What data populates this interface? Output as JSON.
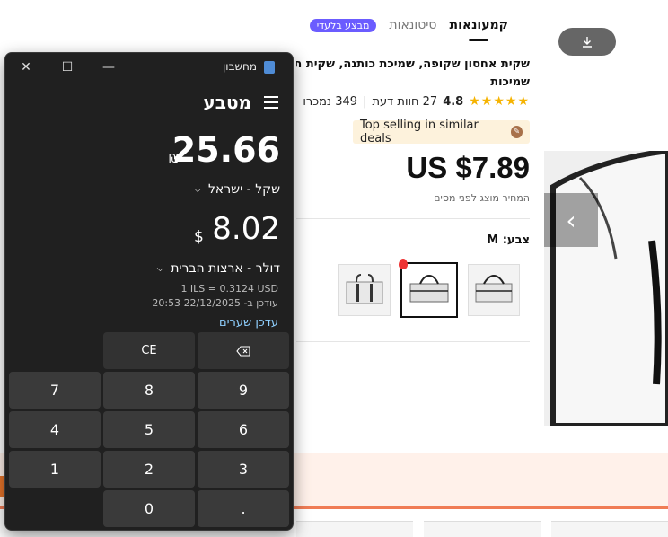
{
  "page": {
    "tabs": {
      "active": "קמעונאות",
      "other": "סיטונאות",
      "badge": "מבצע בלעדי"
    },
    "title_line1": "שקית אחסון שקופה, שמיכת כותנה, שקית תנועה",
    "title_line2": "שמיכות",
    "rating": "4.8",
    "reviews": "27 חוות דעת",
    "sold": "349 נמכרו",
    "top_selling": "Top selling in similar deals",
    "price": "US $7.89",
    "price_note": "המחיר מוצג לפני מסים",
    "color_label": "צבע: M"
  },
  "calculator": {
    "app_title": "מחשבון",
    "mode": "מטבע",
    "value1": "25.66",
    "symbol1": "₪",
    "unit1": "שקל - ישראל",
    "value2": "8.02",
    "symbol2": "$",
    "unit2": "דולר - ארצות הברית",
    "rate": "1 ILS = 0.3124 USD",
    "updated": "עודכן ב- 22/12/2025 20:53",
    "update_link": "עדכן שערים",
    "keys": {
      "ce": "CE",
      "k7": "7",
      "k8": "8",
      "k9": "9",
      "k4": "4",
      "k5": "5",
      "k6": "6",
      "k1": "1",
      "k2": "2",
      "k3": "3",
      "k0": "0",
      "dot": "."
    }
  },
  "colors": {
    "accent_badge": "#6b5cff",
    "calc_bg": "#202020",
    "calc_key": "#3a3a3a",
    "link": "#8fd0ff",
    "star": "#f5b301",
    "promo_line": "#f07c55"
  }
}
